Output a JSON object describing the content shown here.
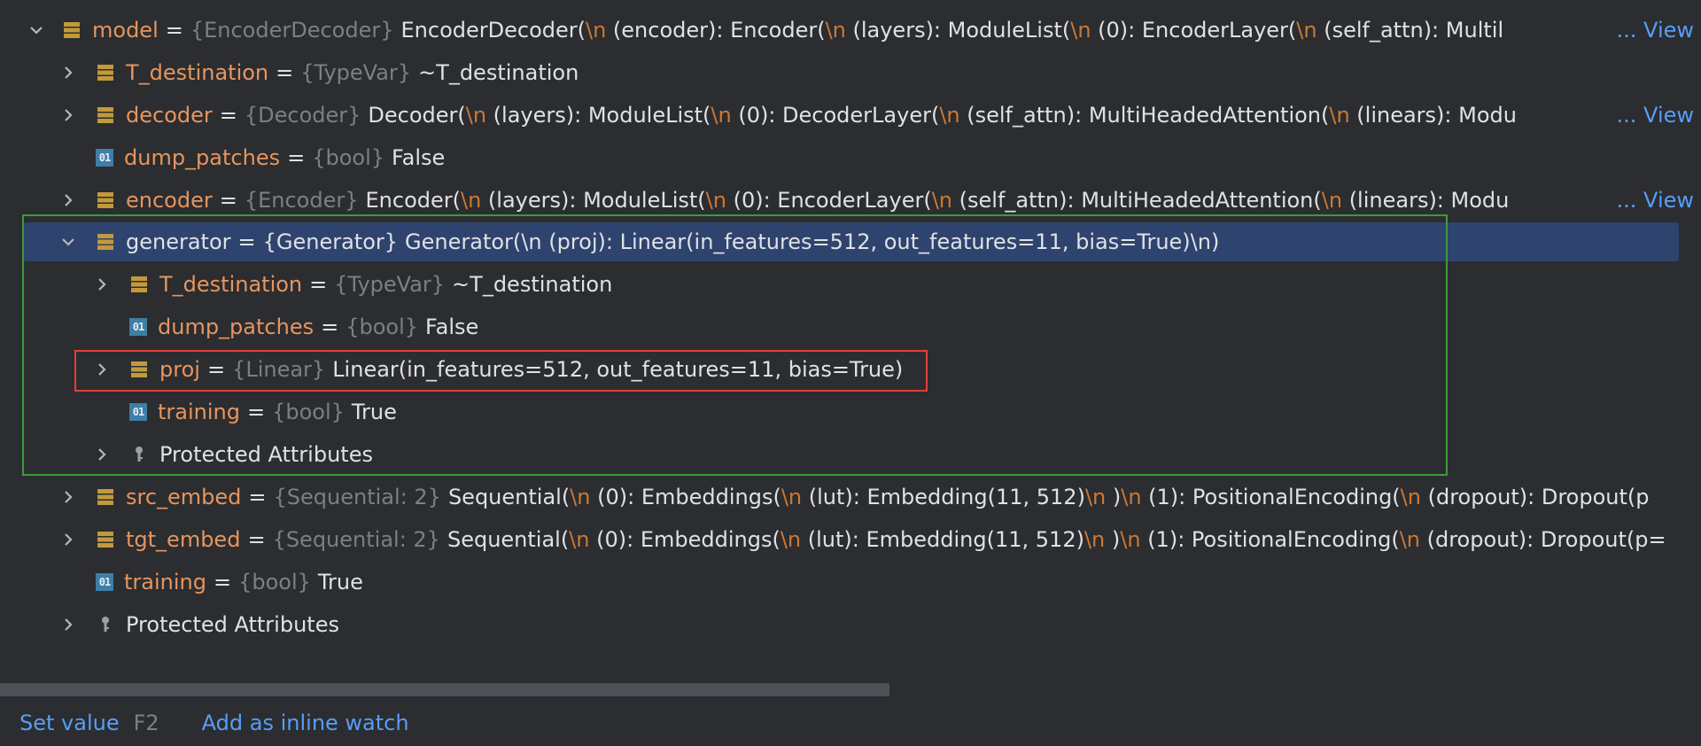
{
  "tree": {
    "rows": [
      {
        "name": "model",
        "type": "{EncoderDecoder}",
        "value": "EncoderDecoder(\\n  (encoder): Encoder(\\n    (layers): ModuleList(\\n      (0): EncoderLayer(\\n        (self_attn): Multil",
        "view": "View"
      },
      {
        "name": "T_destination",
        "type": "{TypeVar}",
        "value": "~T_destination"
      },
      {
        "name": "decoder",
        "type": "{Decoder}",
        "value": "Decoder(\\n  (layers): ModuleList(\\n    (0): DecoderLayer(\\n      (self_attn): MultiHeadedAttention(\\n        (linears): Modu",
        "view": "View"
      },
      {
        "name": "dump_patches",
        "type": "{bool}",
        "value": "False"
      },
      {
        "name": "encoder",
        "type": "{Encoder}",
        "value": "Encoder(\\n  (layers): ModuleList(\\n    (0): EncoderLayer(\\n      (self_attn): MultiHeadedAttention(\\n        (linears): Modu",
        "view": "View"
      },
      {
        "name": "generator",
        "type": "{Generator}",
        "value": "Generator(\\n  (proj): Linear(in_features=512, out_features=11, bias=True)\\n)"
      },
      {
        "name": "T_destination",
        "type": "{TypeVar}",
        "value": "~T_destination"
      },
      {
        "name": "dump_patches",
        "type": "{bool}",
        "value": "False"
      },
      {
        "name": "proj",
        "type": "{Linear}",
        "value": "Linear(in_features=512, out_features=11, bias=True)"
      },
      {
        "name": "training",
        "type": "{bool}",
        "value": "True"
      },
      {
        "label": "Protected Attributes"
      },
      {
        "name": "src_embed",
        "type": "{Sequential: 2}",
        "value": "Sequential(\\n  (0): Embeddings(\\n    (lut): Embedding(11, 512)\\n  )\\n  (1): PositionalEncoding(\\n    (dropout): Dropout(p"
      },
      {
        "name": "tgt_embed",
        "type": "{Sequential: 2}",
        "value": "Sequential(\\n  (0): Embeddings(\\n    (lut): Embedding(11, 512)\\n  )\\n  (1): PositionalEncoding(\\n    (dropout): Dropout(p="
      },
      {
        "name": "training",
        "type": "{bool}",
        "value": "True"
      },
      {
        "label": "Protected Attributes"
      }
    ],
    "ellipsis": "..."
  },
  "footer": {
    "set_value": "Set value",
    "set_value_shortcut": "F2",
    "add_watch": "Add as inline watch"
  },
  "colors": {
    "background": "#2b2d30",
    "selection": "#2e436e",
    "name": "#e6955f",
    "type": "#7b7f86",
    "link": "#589df6",
    "highlight_green": "#3d9a3a",
    "highlight_red": "#e0403a"
  }
}
